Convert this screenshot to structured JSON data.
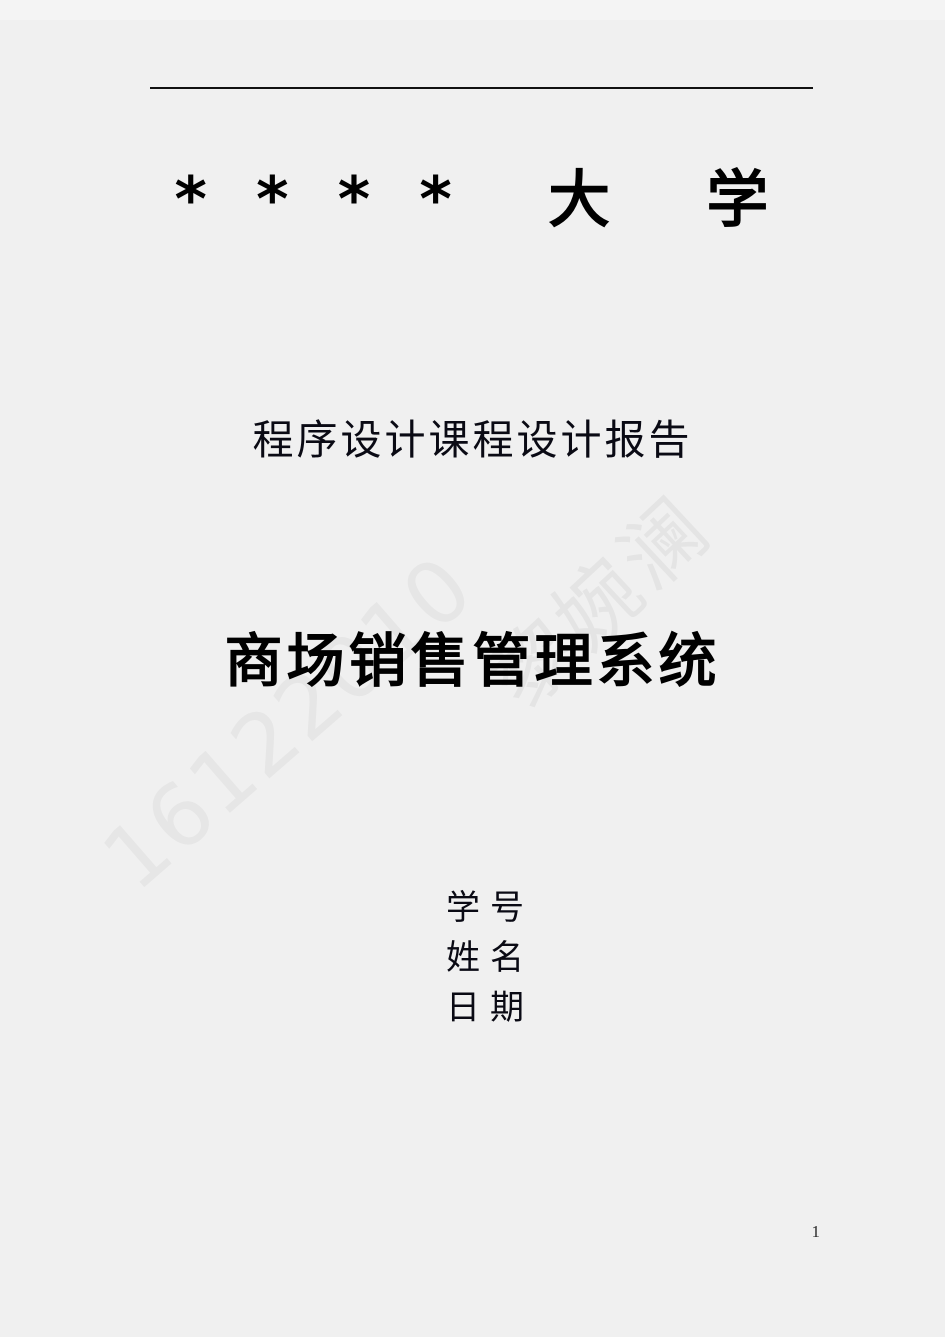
{
  "document": {
    "type": "cover-page",
    "background_color": "#f0f0f0",
    "text_color": "#000000"
  },
  "header": {
    "rule": "horizontal-rule",
    "university": "*  *  *  *    大    学"
  },
  "body": {
    "report_type": "程序设计课程设计报告",
    "project_title": "商场销售管理系统"
  },
  "meta": {
    "fields": [
      {
        "label": "学号",
        "value": ""
      },
      {
        "label": "姓名",
        "value": ""
      },
      {
        "label": "日期",
        "value": ""
      }
    ]
  },
  "watermarks": {
    "student_number": "16122010",
    "student_name": "黎婉澜",
    "color": "#e5e5e5"
  },
  "footer": {
    "page_number": "1"
  }
}
